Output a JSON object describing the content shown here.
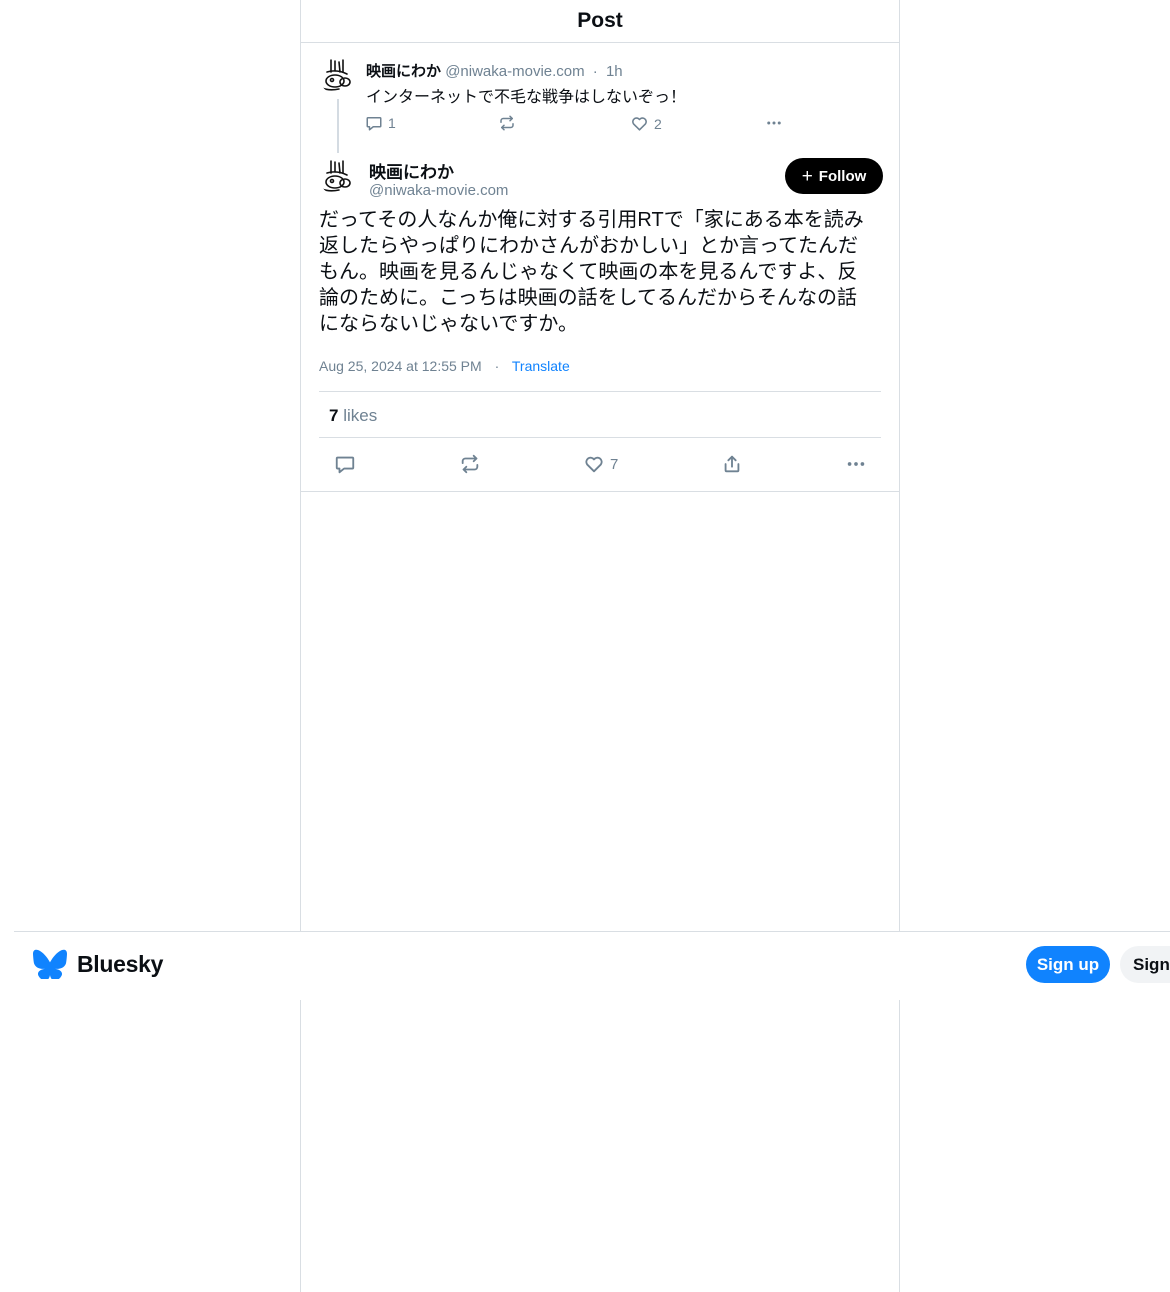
{
  "header": {
    "title": "Post"
  },
  "parent_post": {
    "author_name": "映画にわか",
    "handle": "@niwaka-movie.com",
    "separator": "·",
    "time": "1h",
    "text": "インターネットで不毛な戦争はしないぞっ！",
    "reply_count": "1",
    "repost_count": "",
    "like_count": "2"
  },
  "main_post": {
    "author_name": "映画にわか",
    "handle": "@niwaka-movie.com",
    "follow_label": "Follow",
    "text": "だってその人なんか俺に対する引用RTで「家にある本を読み返したらやっぱりにわかさんがおかしい」とか言ってたんだもん。映画を見るんじゃなくて映画の本を見るんですよ、反論のために。こっちは映画の話をしてるんだからそんなの話にならないじゃないですか。",
    "date": "Aug 25, 2024 at 12:55 PM",
    "separator": "·",
    "translate_label": "Translate",
    "likes_count": "7",
    "likes_label": "likes",
    "like_action_count": "7"
  },
  "bottom_bar": {
    "logo_text": "Bluesky",
    "signup_label": "Sign up",
    "signin_label": "Sign"
  },
  "colors": {
    "accent": "#1083fe",
    "muted": "#6f8292",
    "border": "#d9dee3",
    "text": "#0b0f14"
  },
  "icons": {
    "avatar": "line-drawing-avatar",
    "reply": "speech-bubble-icon",
    "repost": "repost-arrows-icon",
    "like": "heart-icon",
    "share": "share-upload-icon",
    "more": "ellipsis-icon",
    "follow": "plus-icon",
    "logo": "butterfly-icon"
  }
}
